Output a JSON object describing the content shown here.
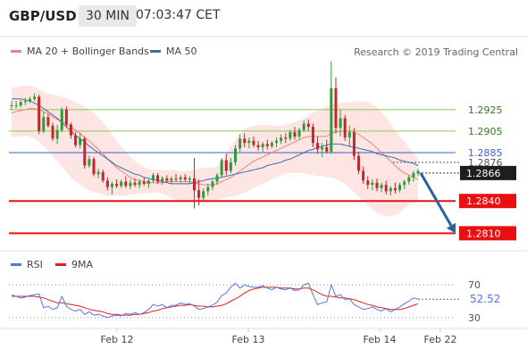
{
  "header": {
    "symbol": "GBP/USD",
    "timeframe": "30 MIN",
    "time": "07:03:47 CET"
  },
  "legend_main": [
    {
      "label": "MA 20 + Bollinger Bands",
      "color": "#f08080"
    },
    {
      "label": "MA 50",
      "color": "#3a6ea5"
    }
  ],
  "credit": "Research © 2019 Trading Central",
  "legend_rsi": [
    {
      "label": "RSI",
      "color": "#5577dd"
    },
    {
      "label": "9MA",
      "color": "#e02020"
    }
  ],
  "colors": {
    "up": "#2e9a3a",
    "down": "#c0282c",
    "ma50": "#3a6ea5",
    "ma20": "#f08080",
    "band": "#fde0de",
    "green_level": "#8fc85a",
    "blue_level": "#3a5fcd",
    "red_level": "#e81010",
    "arrow": "#2c5fa0",
    "rsi": "#5577dd",
    "rsi_ma": "#e02020"
  },
  "chart_data": [
    {
      "type": "candlestick",
      "title": "GBP/USD",
      "timeframe": "30 MIN",
      "x_labels": [
        "Feb 12",
        "Feb 13",
        "Feb 14",
        "Feb 22"
      ],
      "ylim": [
        1.2797,
        1.2973
      ],
      "ohlc": [
        [
          1.2929,
          1.2933,
          1.2925,
          1.2929
        ],
        [
          1.2929,
          1.2933,
          1.2926,
          1.2929
        ],
        [
          1.2929,
          1.2934,
          1.2927,
          1.2932
        ],
        [
          1.2932,
          1.2936,
          1.2929,
          1.2933
        ],
        [
          1.2933,
          1.2937,
          1.2931,
          1.2935
        ],
        [
          1.2935,
          1.294,
          1.2933,
          1.2937
        ],
        [
          1.2937,
          1.2939,
          1.2902,
          1.2905
        ],
        [
          1.2905,
          1.2923,
          1.2903,
          1.2918
        ],
        [
          1.2918,
          1.2921,
          1.2908,
          1.291
        ],
        [
          1.291,
          1.2913,
          1.2896,
          1.2898
        ],
        [
          1.2898,
          1.2911,
          1.2893,
          1.2906
        ],
        [
          1.2906,
          1.2927,
          1.2904,
          1.2925
        ],
        [
          1.2925,
          1.2928,
          1.2908,
          1.2911
        ],
        [
          1.2911,
          1.2913,
          1.2898,
          1.2901
        ],
        [
          1.2901,
          1.2904,
          1.289,
          1.2892
        ],
        [
          1.2892,
          1.2903,
          1.2889,
          1.2898
        ],
        [
          1.2898,
          1.29,
          1.287,
          1.2873
        ],
        [
          1.2873,
          1.2882,
          1.2871,
          1.2879
        ],
        [
          1.2879,
          1.2881,
          1.2863,
          1.2865
        ],
        [
          1.2865,
          1.287,
          1.2861,
          1.2867
        ],
        [
          1.2867,
          1.2869,
          1.2857,
          1.2859
        ],
        [
          1.2859,
          1.2862,
          1.285,
          1.2853
        ],
        [
          1.2853,
          1.2858,
          1.2846,
          1.2856
        ],
        [
          1.2856,
          1.286,
          1.2852,
          1.2854
        ],
        [
          1.2854,
          1.286,
          1.2852,
          1.2858
        ],
        [
          1.2858,
          1.2863,
          1.2852,
          1.2854
        ],
        [
          1.2854,
          1.286,
          1.2851,
          1.2857
        ],
        [
          1.2857,
          1.2861,
          1.2853,
          1.2855
        ],
        [
          1.2855,
          1.286,
          1.2852,
          1.2858
        ],
        [
          1.2858,
          1.2862,
          1.2854,
          1.2856
        ],
        [
          1.2856,
          1.286,
          1.2852,
          1.2859
        ],
        [
          1.2859,
          1.2866,
          1.2857,
          1.2864
        ],
        [
          1.2864,
          1.2866,
          1.2856,
          1.2858
        ],
        [
          1.2858,
          1.2863,
          1.2855,
          1.2861
        ],
        [
          1.2861,
          1.2864,
          1.2857,
          1.2859
        ],
        [
          1.2859,
          1.2863,
          1.2856,
          1.2861
        ],
        [
          1.2861,
          1.2865,
          1.2858,
          1.286
        ],
        [
          1.286,
          1.2864,
          1.2857,
          1.2862
        ],
        [
          1.2862,
          1.2865,
          1.2858,
          1.286
        ],
        [
          1.286,
          1.2863,
          1.2856,
          1.2861
        ],
        [
          1.2861,
          1.288,
          1.2833,
          1.285
        ],
        [
          1.285,
          1.286,
          1.2836,
          1.2843
        ],
        [
          1.2843,
          1.2852,
          1.284,
          1.2849
        ],
        [
          1.2849,
          1.2856,
          1.2845,
          1.2853
        ],
        [
          1.2853,
          1.286,
          1.285,
          1.2858
        ],
        [
          1.2858,
          1.2866,
          1.2855,
          1.2864
        ],
        [
          1.2864,
          1.288,
          1.2862,
          1.2878
        ],
        [
          1.2878,
          1.2884,
          1.2864,
          1.2868
        ],
        [
          1.2868,
          1.288,
          1.2866,
          1.2876
        ],
        [
          1.2876,
          1.2892,
          1.2873,
          1.2889
        ],
        [
          1.2889,
          1.2902,
          1.2886,
          1.2898
        ],
        [
          1.2898,
          1.2903,
          1.289,
          1.2894
        ],
        [
          1.2894,
          1.2899,
          1.2889,
          1.2896
        ],
        [
          1.2896,
          1.29,
          1.289,
          1.2892
        ],
        [
          1.2892,
          1.2896,
          1.2887,
          1.289
        ],
        [
          1.289,
          1.2895,
          1.2886,
          1.2893
        ],
        [
          1.2893,
          1.2897,
          1.2888,
          1.2891
        ],
        [
          1.2891,
          1.2896,
          1.2889,
          1.2894
        ],
        [
          1.2894,
          1.2899,
          1.289,
          1.2896
        ],
        [
          1.2896,
          1.2902,
          1.2893,
          1.2899
        ],
        [
          1.2899,
          1.2903,
          1.2894,
          1.2898
        ],
        [
          1.2898,
          1.2906,
          1.2896,
          1.2904
        ],
        [
          1.2904,
          1.2909,
          1.2897,
          1.29
        ],
        [
          1.29,
          1.2908,
          1.2898,
          1.2906
        ],
        [
          1.2906,
          1.2915,
          1.2904,
          1.2912
        ],
        [
          1.2912,
          1.2916,
          1.2905,
          1.2909
        ],
        [
          1.2909,
          1.2912,
          1.289,
          1.2894
        ],
        [
          1.2894,
          1.29,
          1.2884,
          1.2888
        ],
        [
          1.2888,
          1.2894,
          1.2881,
          1.289
        ],
        [
          1.289,
          1.2897,
          1.2884,
          1.2886
        ],
        [
          1.2886,
          1.297,
          1.2884,
          1.2945
        ],
        [
          1.2945,
          1.2955,
          1.2903,
          1.2908
        ],
        [
          1.2908,
          1.2925,
          1.29,
          1.2917
        ],
        [
          1.2917,
          1.292,
          1.2896,
          1.2899
        ],
        [
          1.2899,
          1.291,
          1.289,
          1.2904
        ],
        [
          1.2904,
          1.2908,
          1.2878,
          1.2882
        ],
        [
          1.2882,
          1.2886,
          1.2865,
          1.2868
        ],
        [
          1.2868,
          1.2872,
          1.2856,
          1.2859
        ],
        [
          1.2859,
          1.2863,
          1.2851,
          1.2855
        ],
        [
          1.2855,
          1.286,
          1.285,
          1.2857
        ],
        [
          1.2857,
          1.2861,
          1.2849,
          1.2852
        ],
        [
          1.2852,
          1.2857,
          1.2848,
          1.2855
        ],
        [
          1.2855,
          1.2859,
          1.2846,
          1.2849
        ],
        [
          1.2849,
          1.2854,
          1.2845,
          1.2852
        ],
        [
          1.2852,
          1.2857,
          1.2847,
          1.285
        ],
        [
          1.285,
          1.2857,
          1.2848,
          1.2855
        ],
        [
          1.2855,
          1.286,
          1.2851,
          1.2858
        ],
        [
          1.2858,
          1.2864,
          1.2855,
          1.2862
        ],
        [
          1.2862,
          1.2868,
          1.2858,
          1.2866
        ],
        [
          1.2866,
          1.287,
          1.2863,
          1.2868
        ]
      ],
      "ma20": [
        1.2922,
        1.2923,
        1.2924,
        1.2925,
        1.2926,
        1.2926,
        1.2925,
        1.2923,
        1.2921,
        1.2918,
        1.2916,
        1.2914,
        1.2912,
        1.2909,
        1.2906,
        1.2903,
        1.2899,
        1.2896,
        1.2892,
        1.2888,
        1.2884,
        1.2879,
        1.2875,
        1.2871,
        1.2868,
        1.2865,
        1.2862,
        1.286,
        1.2859,
        1.2858,
        1.2857,
        1.2857,
        1.2857,
        1.2857,
        1.2858,
        1.2858,
        1.2858,
        1.2858,
        1.2858,
        1.2858,
        1.2857,
        1.2856,
        1.2855,
        1.2855,
        1.2855,
        1.2856,
        1.2858,
        1.286,
        1.2862,
        1.2865,
        1.2868,
        1.2871,
        1.2874,
        1.2877,
        1.2879,
        1.2881,
        1.2883,
        1.2885,
        1.2887,
        1.2889,
        1.2891,
        1.2893,
        1.2895,
        1.2897,
        1.2899,
        1.29,
        1.29,
        1.29,
        1.29,
        1.29,
        1.2903,
        1.2904,
        1.2905,
        1.2905,
        1.2905,
        1.2904,
        1.2902,
        1.2899,
        1.2896,
        1.2893,
        1.2889,
        1.2885,
        1.2881,
        1.2877,
        1.2873,
        1.2869,
        1.2866,
        1.2864,
        1.2862,
        1.286
      ],
      "bb_upper": [
        1.2945,
        1.2946,
        1.2947,
        1.2947,
        1.2947,
        1.2946,
        1.2944,
        1.2941,
        1.294,
        1.2939,
        1.2938,
        1.2937,
        1.2936,
        1.2934,
        1.2932,
        1.293,
        1.2928,
        1.2925,
        1.2922,
        1.2918,
        1.2913,
        1.2908,
        1.2902,
        1.2896,
        1.2891,
        1.2886,
        1.2881,
        1.2877,
        1.2874,
        1.2872,
        1.287,
        1.2869,
        1.2869,
        1.2869,
        1.2869,
        1.2869,
        1.2869,
        1.2868,
        1.2868,
        1.2868,
        1.2869,
        1.287,
        1.2871,
        1.2871,
        1.2871,
        1.2872,
        1.2877,
        1.2884,
        1.2891,
        1.2897,
        1.2903,
        1.2907,
        1.2909,
        1.291,
        1.2911,
        1.2911,
        1.2911,
        1.291,
        1.291,
        1.291,
        1.2911,
        1.2912,
        1.2913,
        1.2915,
        1.2917,
        1.2919,
        1.2922,
        1.2924,
        1.2926,
        1.2928,
        1.293,
        1.293,
        1.2931,
        1.2932,
        1.2932,
        1.2933,
        1.2933,
        1.2933,
        1.2932,
        1.293,
        1.2927,
        1.2923,
        1.2918,
        1.2912,
        1.2906,
        1.29,
        1.2895,
        1.289,
        1.2885,
        1.288
      ],
      "bb_lower": [
        1.2899,
        1.29,
        1.29,
        1.2901,
        1.29,
        1.2898,
        1.2895,
        1.2891,
        1.2887,
        1.2882,
        1.2877,
        1.2872,
        1.2867,
        1.2862,
        1.2858,
        1.2855,
        1.2852,
        1.285,
        1.2848,
        1.2847,
        1.2846,
        1.2845,
        1.2845,
        1.2845,
        1.2845,
        1.2845,
        1.2846,
        1.2846,
        1.2847,
        1.2847,
        1.2847,
        1.2848,
        1.2848,
        1.2847,
        1.2845,
        1.2843,
        1.2841,
        1.284,
        1.284,
        1.284,
        1.284,
        1.2841,
        1.2841,
        1.2841,
        1.2841,
        1.2841,
        1.2842,
        1.2843,
        1.2844,
        1.2845,
        1.2846,
        1.2848,
        1.285,
        1.2852,
        1.2854,
        1.2856,
        1.2858,
        1.286,
        1.2862,
        1.2864,
        1.2866,
        1.2866,
        1.2866,
        1.2866,
        1.2866,
        1.2865,
        1.2864,
        1.2863,
        1.2863,
        1.2862,
        1.2862,
        1.286,
        1.2858,
        1.2856,
        1.2852,
        1.2848,
        1.2844,
        1.284,
        1.2836,
        1.2832,
        1.2829,
        1.2827,
        1.2826,
        1.2826,
        1.2827,
        1.2829,
        1.2833,
        1.2836,
        1.2838,
        1.284
      ],
      "ma50": [
        1.2935,
        1.2935,
        1.2935,
        1.2934,
        1.2933,
        1.2931,
        1.2929,
        1.2926,
        1.2923,
        1.292,
        1.2917,
        1.2913,
        1.2909,
        1.2905,
        1.2901,
        1.2898,
        1.2895,
        1.2891,
        1.2888,
        1.2885,
        1.2882,
        1.2879,
        1.2876,
        1.2873,
        1.2871,
        1.2869,
        1.2867,
        1.2865,
        1.2864,
        1.2862,
        1.2861,
        1.286,
        1.2859,
        1.2858,
        1.2857,
        1.2856,
        1.2856,
        1.2856,
        1.2856,
        1.2856,
        1.2857,
        1.2858,
        1.2859,
        1.286,
        1.2861,
        1.2861,
        1.2862,
        1.2863,
        1.2864,
        1.2865,
        1.2866,
        1.2867,
        1.2868,
        1.2869,
        1.287,
        1.2871,
        1.2873,
        1.2874,
        1.2875,
        1.2876,
        1.2878,
        1.2879,
        1.2881,
        1.2883,
        1.2885,
        1.2887,
        1.2888,
        1.289,
        1.2891,
        1.2892,
        1.2893,
        1.2893,
        1.2893,
        1.2892,
        1.2891,
        1.289,
        1.2889,
        1.2888,
        1.2887,
        1.2886,
        1.2884,
        1.2883,
        1.2882,
        1.2881,
        1.288,
        1.2878,
        1.2877,
        1.2876,
        1.2875,
        1.2873
      ],
      "levels": [
        {
          "value": 1.2925,
          "label": "1.2925",
          "kind": "green"
        },
        {
          "value": 1.2905,
          "label": "1.2905",
          "kind": "green"
        },
        {
          "value": 1.2885,
          "label": "1.2885",
          "kind": "blue"
        },
        {
          "value": 1.284,
          "label": "1.2840",
          "kind": "red"
        },
        {
          "value": 1.281,
          "label": "1.2810",
          "kind": "red"
        }
      ],
      "pivot": {
        "value": 1.2876,
        "label": "1.2876"
      },
      "last_price": {
        "value": 1.2866,
        "label": "1.2866"
      },
      "forecast_arrow": {
        "from": 1.2866,
        "to": 1.281
      }
    },
    {
      "type": "line",
      "title": "RSI",
      "ylim": [
        20,
        80
      ],
      "y_ticks": [
        {
          "value": 70,
          "label": "70"
        },
        {
          "value": 30,
          "label": "30"
        }
      ],
      "current": {
        "value": 52.52,
        "label": "52.52"
      },
      "rsi": [
        58,
        56,
        54,
        55,
        57,
        58,
        59,
        42,
        44,
        40,
        42,
        56,
        44,
        40,
        38,
        40,
        34,
        37,
        33,
        34,
        32,
        30,
        32,
        33,
        32,
        35,
        34,
        36,
        34,
        36,
        40,
        46,
        44,
        46,
        42,
        45,
        45,
        48,
        46,
        47,
        44,
        40,
        41,
        43,
        45,
        49,
        57,
        60,
        67,
        72,
        66,
        70,
        68,
        67,
        67,
        69,
        66,
        64,
        67,
        65,
        64,
        66,
        63,
        64,
        70,
        72,
        58,
        46,
        48,
        49,
        70,
        56,
        58,
        52,
        53,
        46,
        43,
        40,
        41,
        43,
        40,
        38,
        41,
        37,
        40,
        43,
        47,
        50,
        54,
        52.5
      ],
      "rsi_ma": [
        56,
        56,
        56,
        56,
        56,
        56,
        55,
        54,
        52,
        50,
        48,
        48,
        47,
        46,
        45,
        44,
        42,
        40,
        39,
        38,
        37,
        35,
        34,
        34,
        33,
        33,
        33,
        34,
        34,
        35,
        36,
        38,
        39,
        41,
        42,
        43,
        44,
        45,
        45,
        46,
        45,
        44,
        44,
        43,
        43,
        44,
        45,
        47,
        50,
        53,
        56,
        60,
        63,
        65,
        66,
        67,
        67,
        67,
        67,
        66,
        66,
        66,
        65,
        65,
        66,
        66,
        64,
        61,
        58,
        56,
        56,
        55,
        54,
        54,
        53,
        52,
        50,
        48,
        46,
        45,
        43,
        42,
        41,
        40,
        40,
        40,
        41,
        43,
        45,
        47
      ]
    }
  ]
}
